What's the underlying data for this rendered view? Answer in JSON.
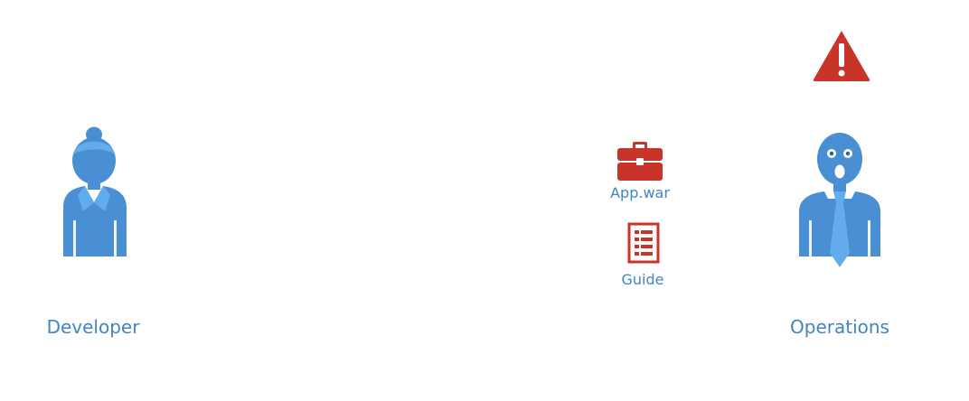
{
  "developer": {
    "label": "Developer",
    "icon": "developer-woman-icon"
  },
  "operations": {
    "label": "Operations",
    "icon": "operations-man-shocked-icon"
  },
  "warning": {
    "icon": "warning-triangle-icon"
  },
  "artifacts": [
    {
      "label": "App.war",
      "icon": "briefcase-icon"
    },
    {
      "label": "Guide",
      "icon": "document-list-icon"
    }
  ],
  "colors": {
    "person_blue": "#4a8fd4",
    "person_light": "#62acec",
    "label_blue": "#3f86c6",
    "accent_red": "#c8342a"
  }
}
